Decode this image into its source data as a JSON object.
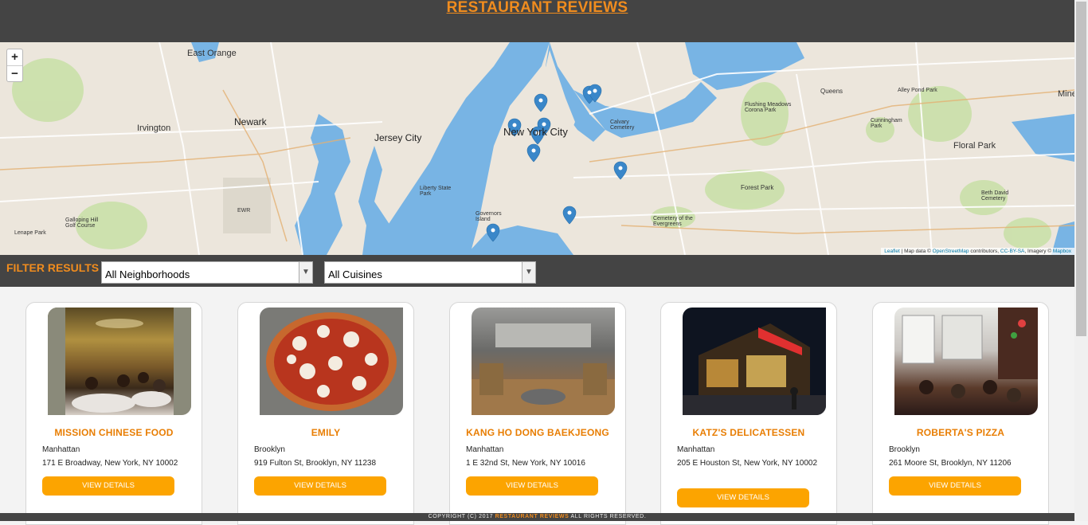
{
  "header": {
    "title": "RESTAURANT REVIEWS"
  },
  "map": {
    "zoom_in": "+",
    "zoom_out": "−",
    "attribution": {
      "leaflet": "Leaflet",
      "text1": " | Map data © ",
      "osm": "OpenStreetMap",
      "text2": " contributors, ",
      "license": "CC-BY-SA",
      "text3": ", Imagery © ",
      "mapbox": "Mapbox"
    },
    "labels": [
      "East Orange",
      "Newark",
      "Irvington",
      "Jersey City",
      "New York City",
      "Floral Park",
      "Queens",
      "Forest Park",
      "Liberty State Park",
      "Governors Island",
      "Galloping Hill Golf Course",
      "Lenape Park",
      "Alley Pond Park",
      "Cunningham Park",
      "Flushing Meadows Corona Park",
      "Beth David Cemetery",
      "Calvary Cemetery",
      "Cemetery of the Evergreens",
      "Mine",
      "EWR"
    ],
    "marker_count": 10
  },
  "filter": {
    "heading": "FILTER RESULTS",
    "neighborhood_value": "All Neighborhoods",
    "cuisine_value": "All Cuisines"
  },
  "restaurants": [
    {
      "name": "MISSION CHINESE FOOD",
      "neighborhood": "Manhattan",
      "address": "171 E Broadway, New York, NY 10002",
      "button": "VIEW DETAILS"
    },
    {
      "name": "EMILY",
      "neighborhood": "Brooklyn",
      "address": "919 Fulton St, Brooklyn, NY 11238",
      "button": "VIEW DETAILS"
    },
    {
      "name": "KANG HO DONG BAEKJEONG",
      "neighborhood": "Manhattan",
      "address": "1 E 32nd St, New York, NY 10016",
      "button": "VIEW DETAILS"
    },
    {
      "name": "KATZ'S DELICATESSEN",
      "neighborhood": "Manhattan",
      "address": "205 E Houston St, New York, NY 10002",
      "button": "VIEW DETAILS"
    },
    {
      "name": "ROBERTA'S PIZZA",
      "neighborhood": "Brooklyn",
      "address": "261 Moore St, Brooklyn, NY 11206",
      "button": "VIEW DETAILS"
    }
  ],
  "footer": {
    "prefix": "COPYRIGHT (C) 2017 ",
    "brand": "RESTAURANT REVIEWS",
    "suffix": " ALL RIGHTS RESERVED."
  },
  "colors": {
    "accent": "#f08c1e",
    "button": "#fca400",
    "header_bg": "#444444",
    "water": "#78b4e4",
    "marker": "#3a87c9"
  }
}
